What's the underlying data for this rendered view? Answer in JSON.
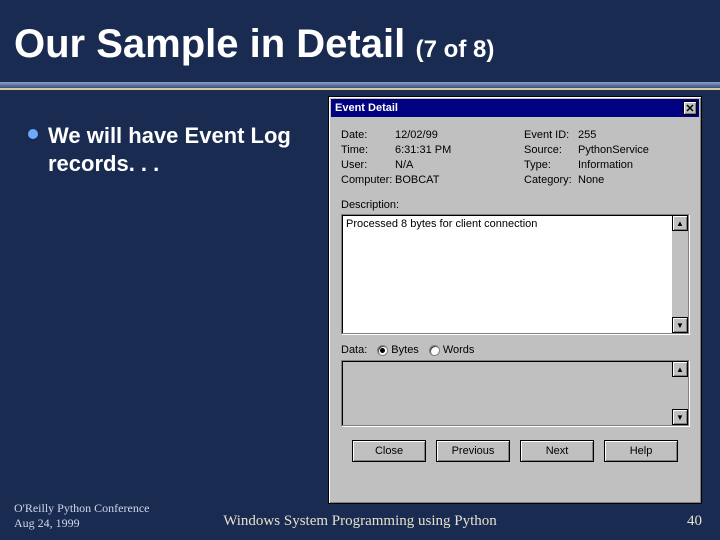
{
  "title_main": "Our Sample in Detail",
  "title_sub": "(7 of 8)",
  "bullet": "We will have Event Log records. . .",
  "footer": {
    "conf": "O'Reilly Python Conference",
    "date": "Aug 24, 1999",
    "center": "Windows System Programming using Python",
    "pagenum": "40"
  },
  "dialog": {
    "title": "Event Detail",
    "fields_left": {
      "date_label": "Date:",
      "date_val": "12/02/99",
      "time_label": "Time:",
      "time_val": "6:31:31 PM",
      "user_label": "User:",
      "user_val": "N/A",
      "computer_label": "Computer:",
      "computer_val": "BOBCAT"
    },
    "fields_right": {
      "eventid_label": "Event ID:",
      "eventid_val": "255",
      "source_label": "Source:",
      "source_val": "PythonService",
      "type_label": "Type:",
      "type_val": "Information",
      "category_label": "Category:",
      "category_val": "None"
    },
    "description_label": "Description:",
    "description_text": "Processed 8 bytes for client connection",
    "data_label": "Data:",
    "radio_bytes": "Bytes",
    "radio_words": "Words",
    "buttons": {
      "close": "Close",
      "previous": "Previous",
      "next": "Next",
      "help": "Help"
    }
  }
}
